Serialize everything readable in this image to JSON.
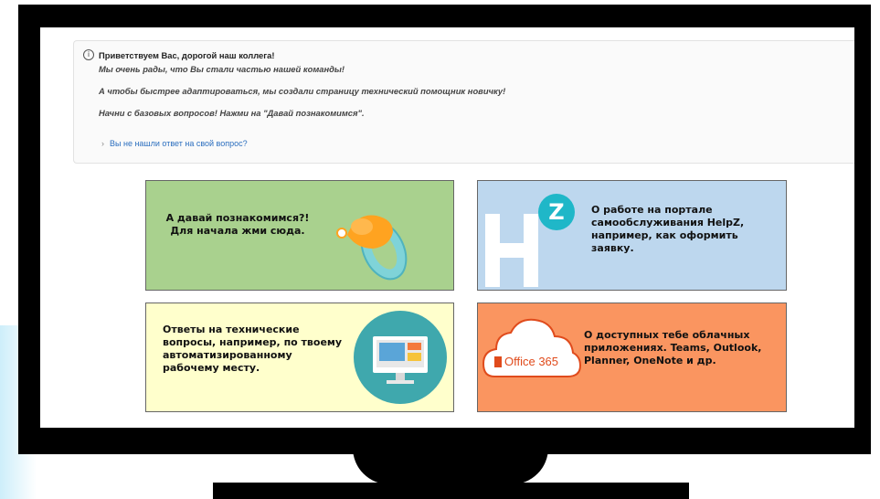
{
  "notice": {
    "title": "Приветствуем Вас, дорогой наш коллега!",
    "line1": "Мы очень рады, что Вы стали частью нашей команды!",
    "line2": "А чтобы быстрее адаптироваться, мы создали страницу технический помощник новичку!",
    "line3": "Начни с базовых вопросов! Нажми на \"Давай познакомимся\".",
    "link": "Вы не нашли ответ на свой вопрос?"
  },
  "tiles": [
    {
      "lines": [
        "А давай познакомимся?!",
        "Для начала жми сюда."
      ],
      "color": "#a9d18e",
      "icon": "pacifier-icon"
    },
    {
      "lines": [
        "О работе на портале",
        "самообслуживания HelpZ,",
        "например, как оформить",
        "заявку."
      ],
      "color": "#bdd7ee",
      "icon": "helpz-logo-icon"
    },
    {
      "lines": [
        "Ответы на технические",
        "вопросы, например, по твоему",
        "автоматизированному",
        "рабочему месту."
      ],
      "color": "#ffffcc",
      "icon": "monitor-icon"
    },
    {
      "lines": [
        "О доступных тебе облачных",
        "приложениях. Teams, Outlook,",
        "Planner, OneNote и др."
      ],
      "color": "#fa9560",
      "icon": "office365-cloud-icon"
    }
  ],
  "office_logo_text": "Office 365",
  "helpz_badge": "Z"
}
